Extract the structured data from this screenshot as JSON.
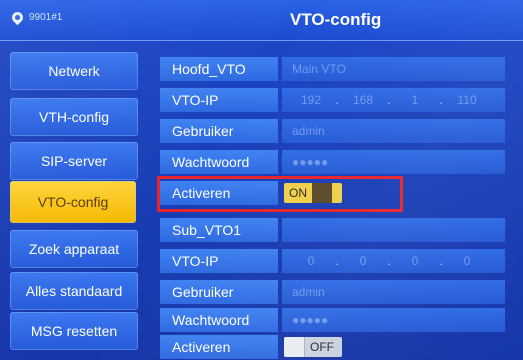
{
  "header": {
    "device_id": "9901#1",
    "title": "VTO-config",
    "location_icon": "location-pin-icon"
  },
  "sidebar": {
    "items": [
      {
        "label": "Netwerk"
      },
      {
        "label": "VTH-config"
      },
      {
        "label": "SIP-server"
      },
      {
        "label": "VTO-config",
        "active": true
      },
      {
        "label": "Zoek apparaat"
      },
      {
        "label": "Alles standaard"
      },
      {
        "label": "MSG resetten"
      }
    ]
  },
  "main_vto": {
    "rows": [
      {
        "label": "Hoofd_VTO",
        "value": "Main VTO"
      },
      {
        "label": "VTO-IP",
        "ip": [
          "192",
          "168",
          "1",
          "110"
        ]
      },
      {
        "label": "Gebruiker",
        "value": "admin"
      },
      {
        "label": "Wachtwoord",
        "value": "●●●●●"
      },
      {
        "label": "Activeren",
        "toggle": "ON"
      }
    ]
  },
  "sub_vto": {
    "rows": [
      {
        "label": "Sub_VTO1",
        "value": ""
      },
      {
        "label": "VTO-IP",
        "ip": [
          "0",
          "0",
          "0",
          "0"
        ]
      },
      {
        "label": "Gebruiker",
        "value": "admin"
      },
      {
        "label": "Wachtwoord",
        "value": "●●●●●"
      },
      {
        "label": "Activeren",
        "toggle": "OFF"
      }
    ]
  },
  "colors": {
    "accent_active": "#f5b800",
    "highlight": "#e8232a",
    "panel": "#1d48c8"
  }
}
